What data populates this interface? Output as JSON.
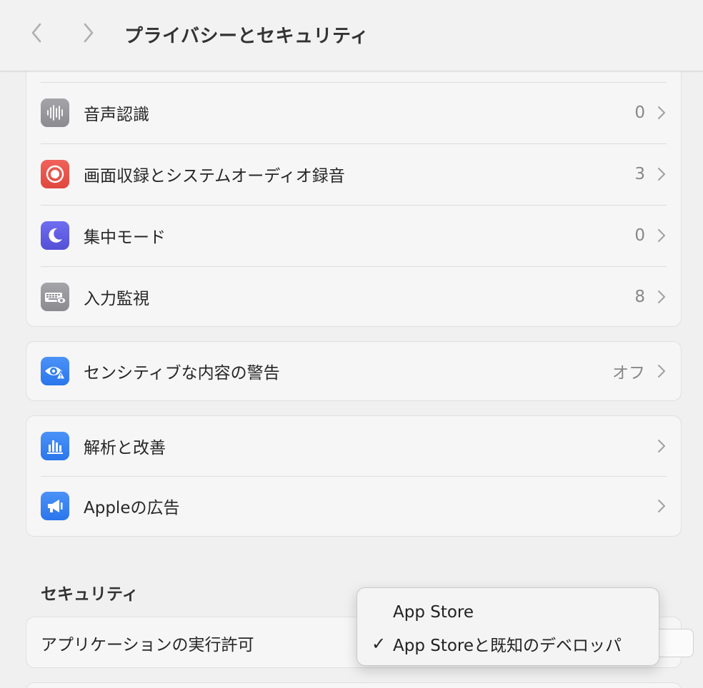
{
  "toolbar": {
    "title": "プライバシーとセキュリティ",
    "back_icon": "chevron-left-icon",
    "forward_icon": "chevron-right-icon"
  },
  "privacy_group_1": {
    "items": [
      {
        "label": "音声認識",
        "value": "0",
        "icon": "waveform-icon",
        "color": "#8e8e93"
      },
      {
        "label": "画面収録とシステムオーディオ録音",
        "value": "3",
        "icon": "record-icon",
        "color": "#ec4f43"
      },
      {
        "label": "集中モード",
        "value": "0",
        "icon": "moon-icon",
        "color": "#5e5ce6"
      },
      {
        "label": "入力監視",
        "value": "8",
        "icon": "keyboard-eye-icon",
        "color": "#8e8e93"
      }
    ]
  },
  "privacy_group_2": {
    "items": [
      {
        "label": "センシティブな内容の警告",
        "value": "オフ",
        "icon": "eye-warning-icon",
        "color": "#2f80f5"
      }
    ]
  },
  "privacy_group_3": {
    "items": [
      {
        "label": "解析と改善",
        "icon": "bar-chart-icon",
        "color": "#2f80f5"
      },
      {
        "label": "Appleの広告",
        "icon": "megaphone-icon",
        "color": "#2f80f5"
      }
    ]
  },
  "security": {
    "title": "セキュリティ",
    "app_permission_label": "アプリケーションの実行許可"
  },
  "dropdown_menu": {
    "options": [
      {
        "label": "App Store",
        "selected": false
      },
      {
        "label": "App Storeと既知のデベロッパ",
        "selected": true
      }
    ],
    "check_glyph": "✓"
  }
}
